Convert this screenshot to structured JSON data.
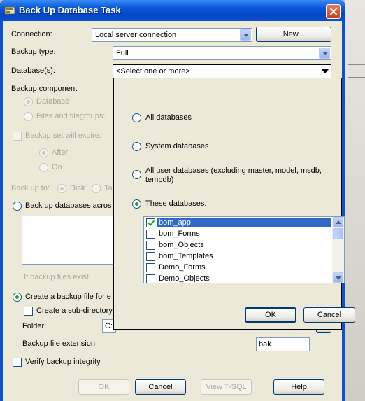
{
  "window": {
    "title": "Back Up Database Task"
  },
  "connection": {
    "label": "Connection:",
    "value": "Local server connection",
    "new_button": "New..."
  },
  "backup_type": {
    "label": "Backup type:",
    "value": "Full"
  },
  "databases": {
    "label": "Database(s):",
    "value": "<Select one or more>"
  },
  "backup_component": {
    "label": "Backup component",
    "database": "Database",
    "files": "Files and filegroups:"
  },
  "expire": {
    "label": "Backup set will expire:",
    "after": "After",
    "on": "On"
  },
  "backup_to": {
    "label": "Back up to:",
    "disk": "Disk",
    "tape": "Ta"
  },
  "across_files": {
    "label": "Back up databases acros"
  },
  "if_exists": {
    "label": "If backup files exist:"
  },
  "create_file": {
    "label": "Create a backup file for e",
    "subdir": "Create a sub-directory",
    "folder_label": "Folder:",
    "folder_value": "C:"
  },
  "extension": {
    "label": "Backup file extension:",
    "value": "bak"
  },
  "verify": {
    "label": "Verify backup integrity"
  },
  "buttons": {
    "ok": "OK",
    "cancel": "Cancel",
    "view_tsql": "View T-SQL",
    "help": "Help"
  },
  "popup": {
    "all": "All databases",
    "system": "System databases",
    "user_line1": "All user databases  (excluding master, model, msdb,",
    "user_line2": "tempdb)",
    "these": "These databases:",
    "items": [
      "bom_app",
      "bom_Forms",
      "bom_Objects",
      "bom_Templates",
      "Demo_Forms",
      "Demo_Objects"
    ],
    "ok": "OK",
    "cancel": "Cancel"
  }
}
